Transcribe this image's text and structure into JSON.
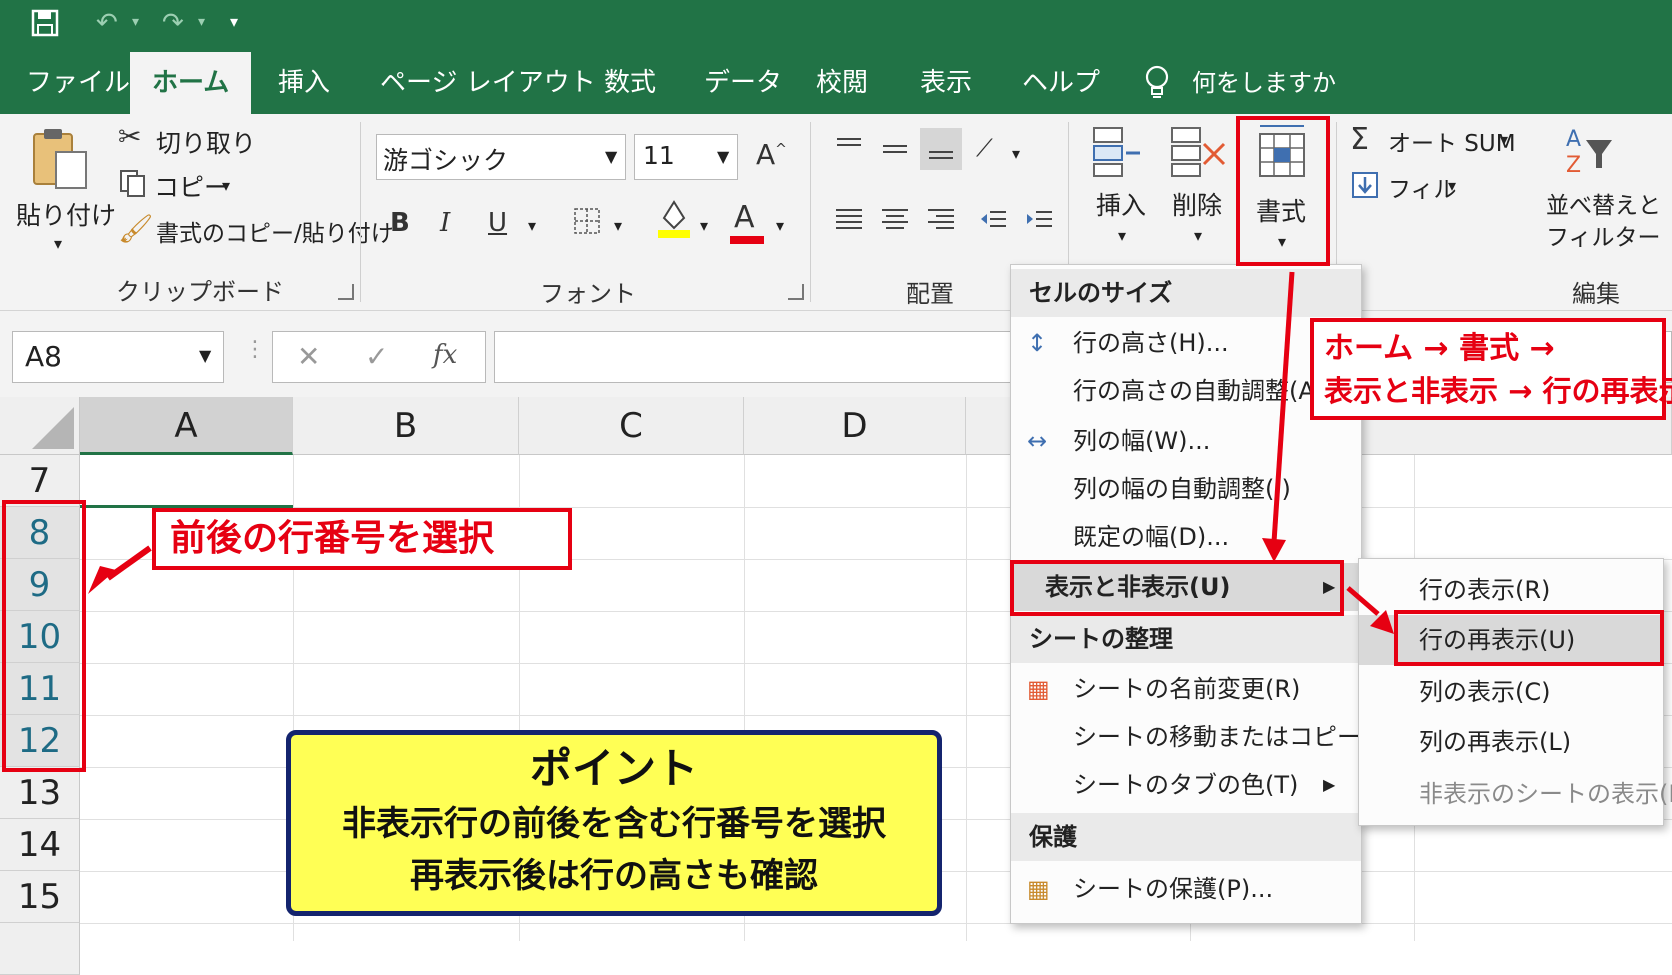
{
  "qat": {
    "save": "save-icon",
    "undo": "undo-icon",
    "redo": "redo-icon",
    "customize": "▾"
  },
  "tabs": [
    "ファイル",
    "ホーム",
    "挿入",
    "ページ レイアウト",
    "数式",
    "データ",
    "校閲",
    "表示",
    "ヘルプ"
  ],
  "tell_me": "何をしますか",
  "clipboard": {
    "paste": "貼り付け",
    "cut": "切り取り",
    "copy": "コピー",
    "format_painter": "書式のコピー/貼り付け",
    "group": "クリップボード"
  },
  "font": {
    "name": "游ゴシック",
    "size": "11",
    "bold": "B",
    "italic": "I",
    "underline": "U",
    "font_color_letter": "A",
    "group": "フォント"
  },
  "alignment": {
    "group": "配置"
  },
  "cells": {
    "insert": "挿入",
    "delete": "削除",
    "format": "書式"
  },
  "editing": {
    "autosum": "オート SUM",
    "fill": "フィル",
    "sort_filter_line1": "並べ替えと",
    "sort_filter_line2": "フィルター",
    "group": "編集"
  },
  "name_box": "A8",
  "formula_bar": {
    "cancel": "✕",
    "enter": "✓",
    "fx": "fx",
    "value": ""
  },
  "columns": [
    "A",
    "B",
    "C",
    "D"
  ],
  "rows": [
    "7",
    "8",
    "9",
    "10",
    "11",
    "12",
    "13",
    "14",
    "15"
  ],
  "format_menu": {
    "sec_cell_size": "セルのサイズ",
    "row_height": "行の高さ(H)...",
    "autofit_row": "行の高さの自動調整(A)",
    "col_width": "列の幅(W)...",
    "autofit_col": "列の幅の自動調整(I)",
    "default_width": "既定の幅(D)...",
    "hide_unhide": "表示と非表示(U)",
    "sec_organize": "シートの整理",
    "rename_sheet": "シートの名前変更(R)",
    "move_copy": "シートの移動またはコピー(M)...",
    "tab_color": "シートのタブの色(T)",
    "sec_protect": "保護",
    "protect_sheet": "シートの保護(P)..."
  },
  "hide_submenu": {
    "show_rows": "行の表示(R)",
    "unhide_rows": "行の再表示(U)",
    "show_cols": "列の表示(C)",
    "unhide_cols": "列の再表示(L)",
    "unhide_sheet": "非表示のシートの表示(H)..."
  },
  "annotations": {
    "path_line1": "ホーム → 書式 →",
    "path_line2": "表示と非表示 → 行の再表示",
    "select_rows": "前後の行番号を選択",
    "point_title": "ポイント",
    "point_line1": "非表示行の前後を含む行番号を選択",
    "point_line2": "再表示後は行の高さも確認"
  },
  "colors": {
    "excel_green": "#217346",
    "accent_red": "#e60012",
    "callout_yellow": "#ffff55",
    "callout_border": "#14246e",
    "row_selected": "#1e6b85"
  }
}
